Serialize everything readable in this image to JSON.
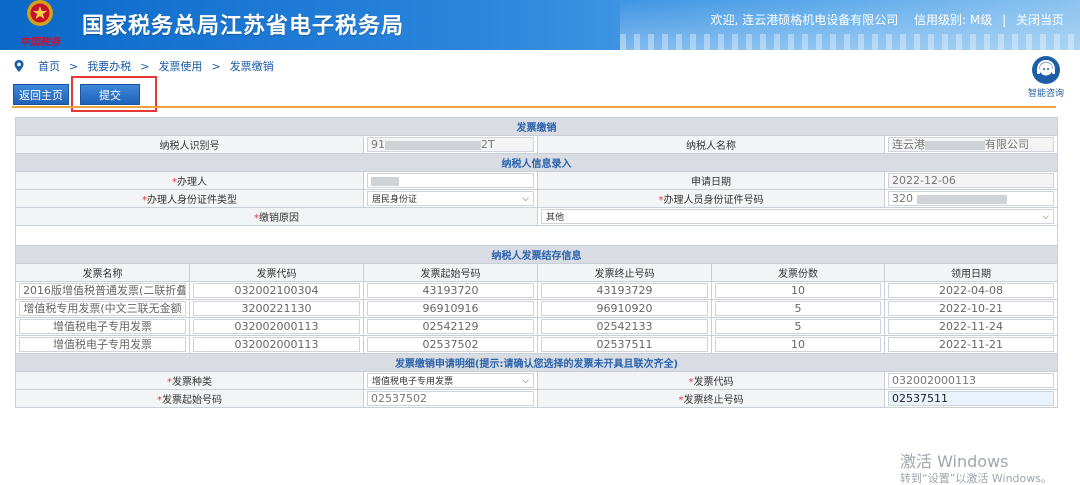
{
  "header": {
    "site_title": "国家税务总局江苏省电子税务局",
    "emblem_text": "中国税务",
    "welcome": "欢迎,",
    "company": "连云港硕格机电设备有限公司",
    "credit_label": "信用级别:",
    "credit_value": "M级",
    "close_label": "关闭当页",
    "separator": "|"
  },
  "breadcrumb": {
    "items": [
      "首页",
      "我要办税",
      "发票使用",
      "发票缴销"
    ],
    "separator": ">"
  },
  "help": {
    "label": "智能咨询"
  },
  "toolbar": {
    "home_label": "返回主页",
    "submit_label": "提交"
  },
  "section1": {
    "title": "发票缴销",
    "taxpayer_id_label": "纳税人识别号",
    "taxpayer_id_prefix": "91",
    "taxpayer_id_suffix": "2T",
    "taxpayer_name_label": "纳税人名称",
    "taxpayer_name_prefix": "连云港",
    "taxpayer_name_suffix": "有限公司"
  },
  "section2": {
    "title": "纳税人信息录入",
    "agent_label": "办理人",
    "apply_date_label": "申请日期",
    "apply_date_value": "2022-12-06",
    "id_type_label": "办理人身份证件类型",
    "id_type_value": "居民身份证",
    "id_no_label": "办理人员身份证件号码",
    "id_no_prefix": "320",
    "reason_label": "缴销原因",
    "reason_value": "其他"
  },
  "section3": {
    "title": "纳税人发票结存信息",
    "columns": [
      "发票名称",
      "发票代码",
      "发票起始号码",
      "发票终止号码",
      "发票份数",
      "领用日期"
    ],
    "rows": [
      [
        "2016版增值税普通发票(二联折叠",
        "032002100304",
        "43193720",
        "43193729",
        "10",
        "2022-04-08"
      ],
      [
        "增值税专用发票(中文三联无金额",
        "3200221130",
        "96910916",
        "96910920",
        "5",
        "2022-10-21"
      ],
      [
        "增值税电子专用发票",
        "032002000113",
        "02542129",
        "02542133",
        "5",
        "2022-11-24"
      ],
      [
        "增值税电子专用发票",
        "032002000113",
        "02537502",
        "02537511",
        "10",
        "2022-11-21"
      ]
    ]
  },
  "section4": {
    "title": "发票缴销申请明细(提示:请确认您选择的发票未开具且联次齐全)",
    "type_label": "发票种类",
    "type_value": "增值税电子专用发票",
    "code_label": "发票代码",
    "code_value": "032002000113",
    "start_label": "发票起始号码",
    "start_value": "02537502",
    "end_label": "发票终止号码",
    "end_value": "02537511"
  },
  "required_mark": "*",
  "watermark": {
    "line1": "激活 Windows",
    "line2": "转到“设置”以激活 Windows。"
  }
}
